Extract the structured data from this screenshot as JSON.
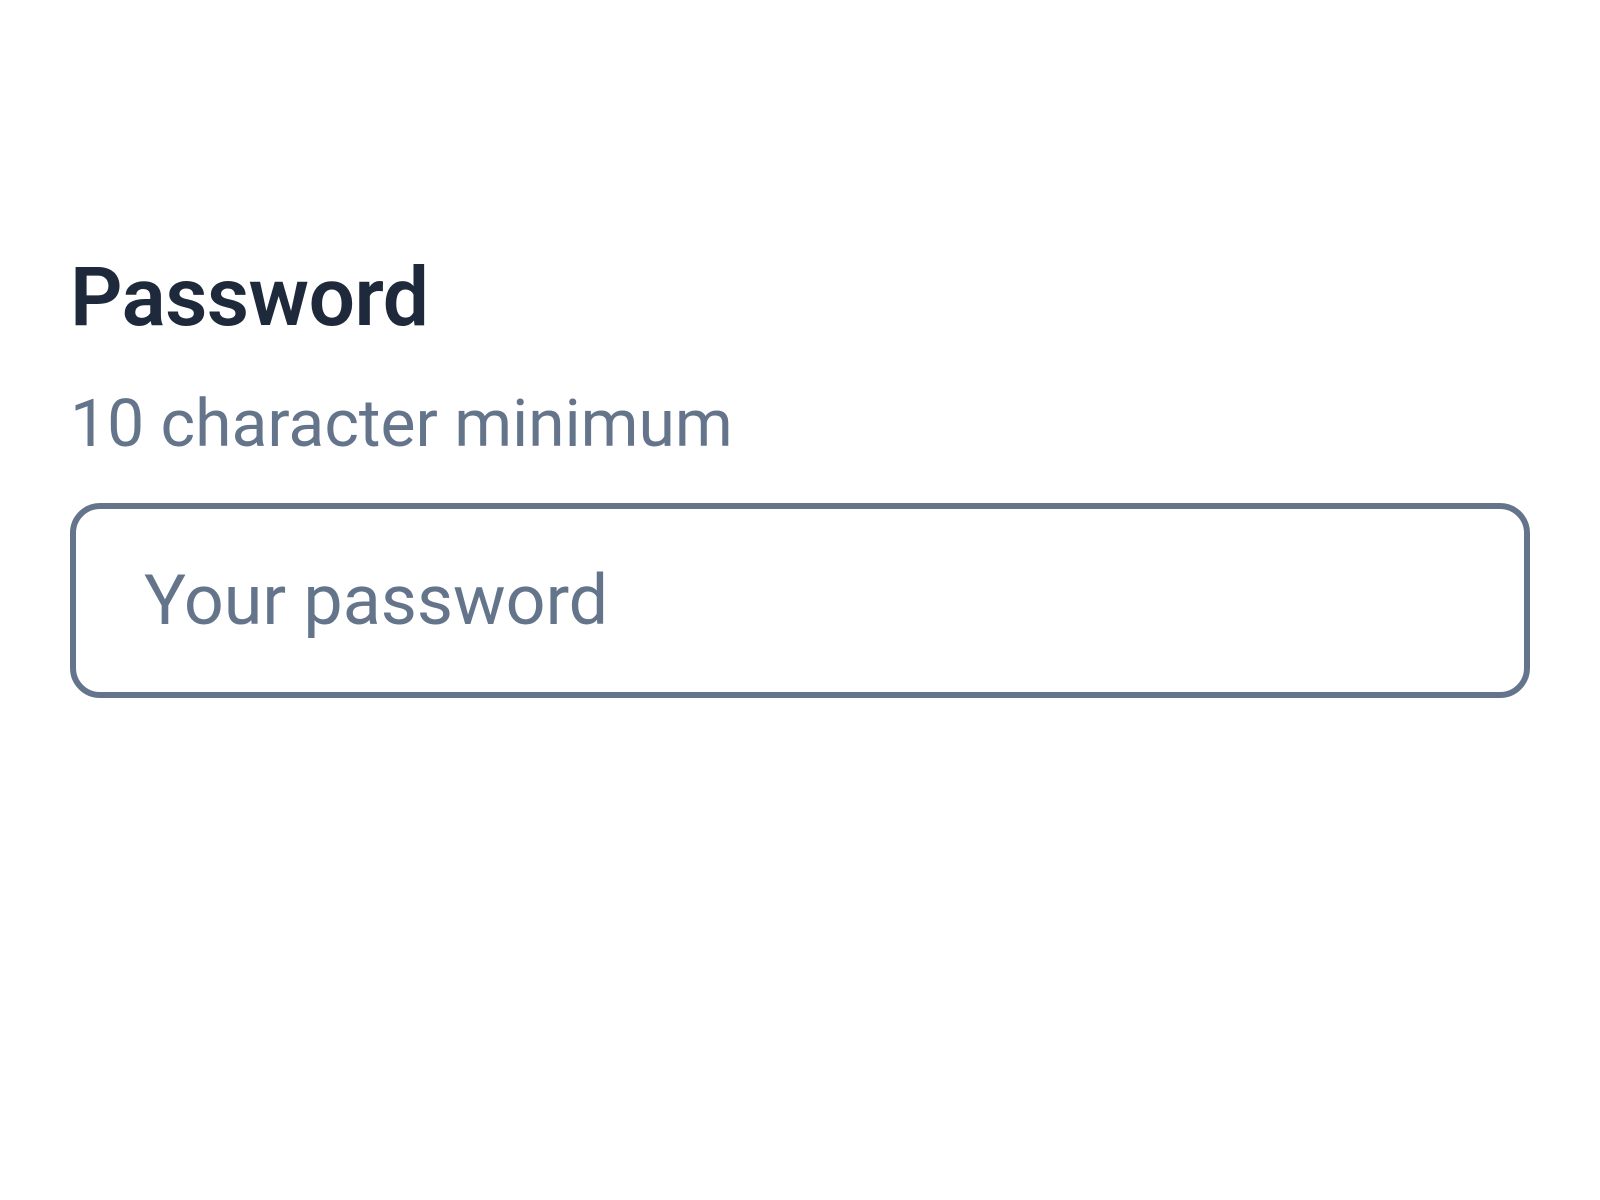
{
  "password_field": {
    "label": "Password",
    "hint": "10 character minimum",
    "placeholder": "Your password",
    "value": ""
  }
}
